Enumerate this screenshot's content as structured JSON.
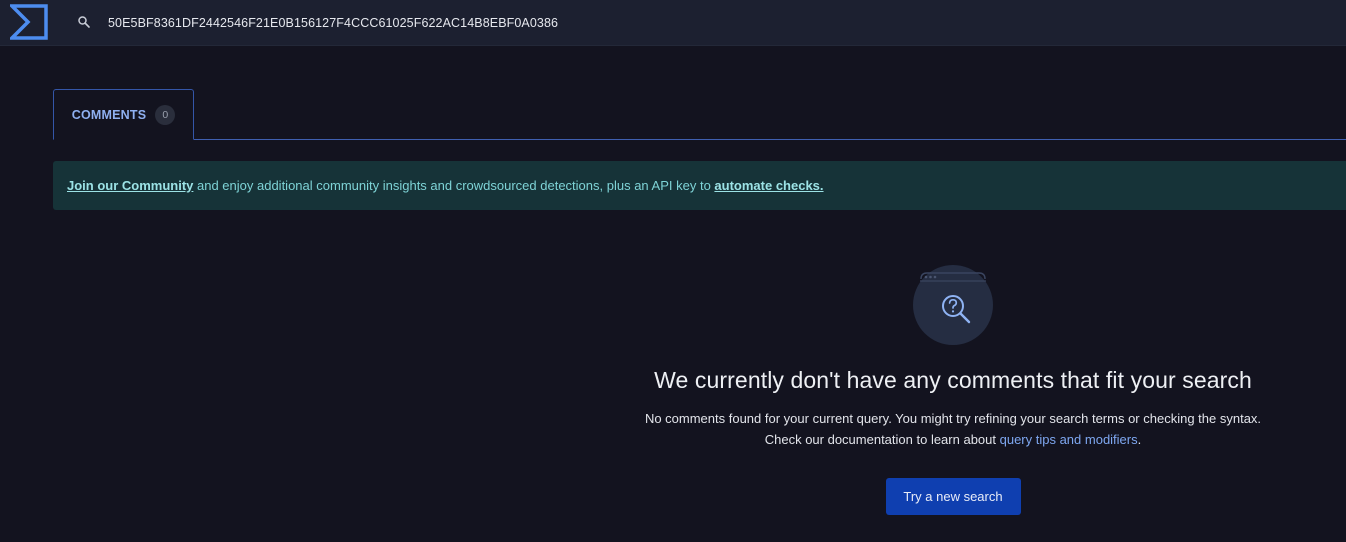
{
  "header": {
    "search_value": "50E5BF8361DF2442546F21E0B156127F4CCC61025F622AC14B8EBF0A0386",
    "logo_icon": "sigma-logo-icon",
    "search_icon": "search-icon"
  },
  "tabs": [
    {
      "label": "COMMENTS",
      "count": "0"
    }
  ],
  "banner": {
    "link1": "Join our Community",
    "text": " and enjoy additional community insights and crowdsourced detections, plus an API key to ",
    "link2": "automate checks."
  },
  "empty_state": {
    "icon": "search-question-icon",
    "title": "We currently don't have any comments that fit your search",
    "desc_line1": "No comments found for your current query. You might try refining your search terms or checking the syntax.",
    "desc_line2_prefix": "Check our documentation to learn about ",
    "desc_link": "query tips and modifiers",
    "desc_line2_suffix": ".",
    "button_label": "Try a new search"
  },
  "colors": {
    "background": "#13131f",
    "topbar": "#1c2030",
    "accent": "#0f3fb0",
    "banner_bg": "#163338",
    "banner_text": "#7ed3d6",
    "link": "#7ea7f0"
  }
}
